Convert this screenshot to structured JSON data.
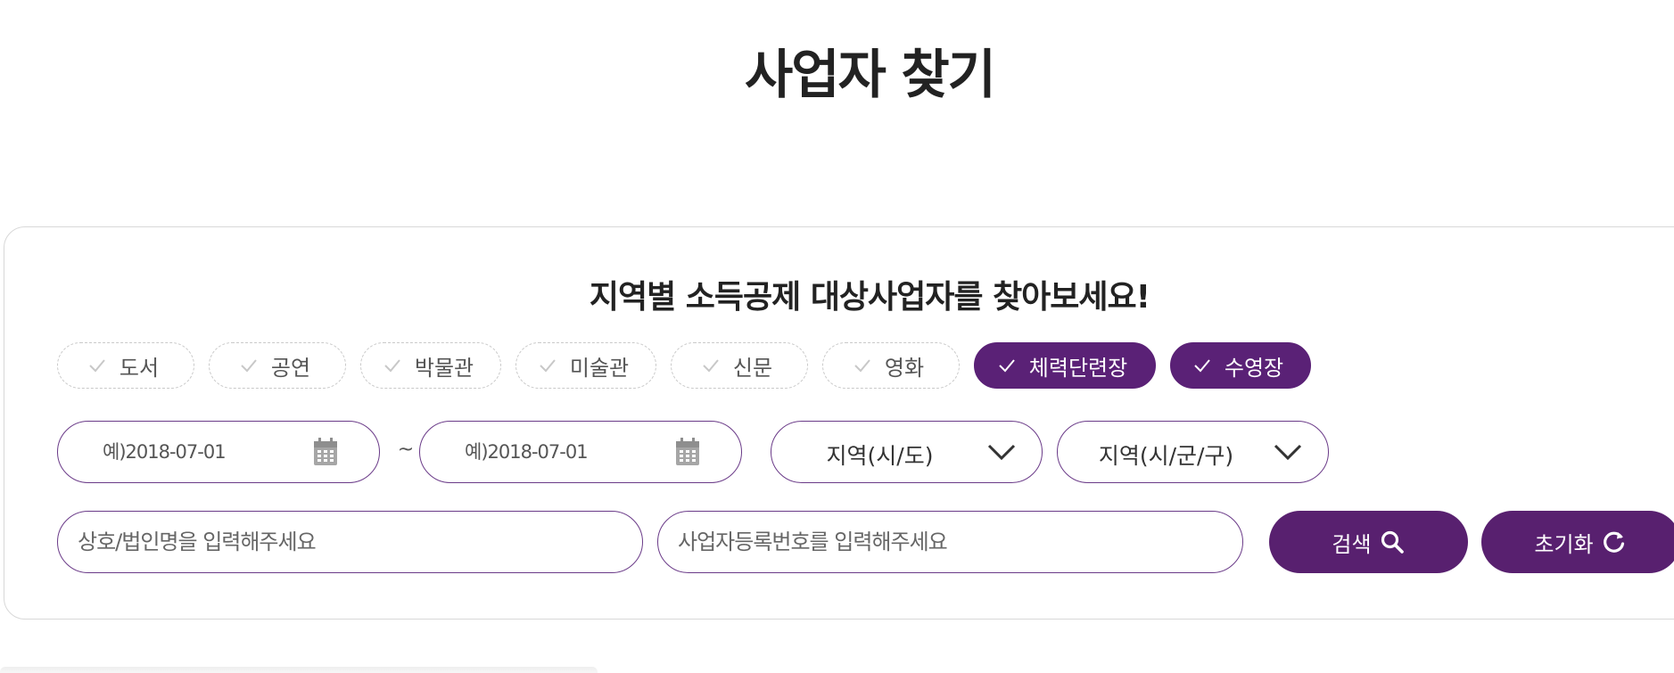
{
  "page": {
    "title": "사업자 찾기"
  },
  "search_panel": {
    "heading": "지역별 소득공제 대상사업자를 찾아보세요!",
    "categories": [
      {
        "label": "도서",
        "selected": false
      },
      {
        "label": "공연",
        "selected": false
      },
      {
        "label": "박물관",
        "selected": false
      },
      {
        "label": "미술관",
        "selected": false
      },
      {
        "label": "신문",
        "selected": false
      },
      {
        "label": "영화",
        "selected": false
      },
      {
        "label": "체력단련장",
        "selected": true
      },
      {
        "label": "수영장",
        "selected": true
      }
    ],
    "date_from": {
      "value": "",
      "placeholder": "예)2018-07-01"
    },
    "date_separator": "~",
    "date_to": {
      "value": "",
      "placeholder": "예)2018-07-01"
    },
    "region_province": {
      "selected": "지역(시/도)"
    },
    "region_district": {
      "selected": "지역(시/군/구)"
    },
    "business_name": {
      "value": "",
      "placeholder": "상호/법인명을 입력해주세요"
    },
    "business_number": {
      "value": "",
      "placeholder": "사업자등록번호를 입력해주세요"
    },
    "search_button": {
      "label": "검색",
      "icon": "search-icon"
    },
    "reset_button": {
      "label": "초기화",
      "icon": "refresh-icon"
    }
  },
  "colors": {
    "accent": "#58206f",
    "input_border": "#6a3a88",
    "chip_border": "#c9c9c9",
    "text": "#222222"
  }
}
